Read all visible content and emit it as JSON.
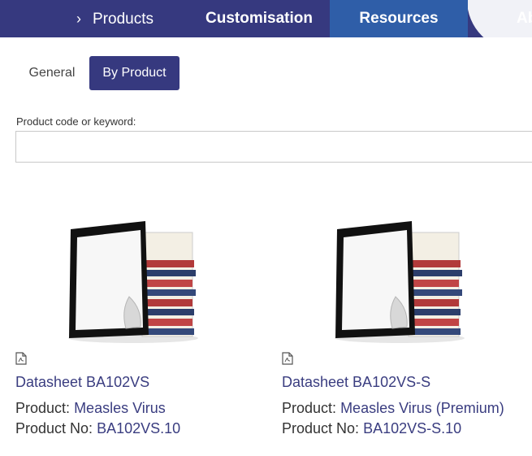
{
  "nav": {
    "items": [
      {
        "label": "Products"
      },
      {
        "label": "Customisation"
      },
      {
        "label": "Resources"
      },
      {
        "label": "Ab"
      }
    ]
  },
  "tabs": [
    {
      "label": "General"
    },
    {
      "label": "By Product"
    }
  ],
  "search": {
    "label": "Product code or keyword:",
    "value": "",
    "placeholder": ""
  },
  "results": [
    {
      "title": "Datasheet BA102VS",
      "product_label": "Product:",
      "product_value": "Measles Virus",
      "number_label": "Product No:",
      "number_value": "BA102VS.10"
    },
    {
      "title": "Datasheet BA102VS-S",
      "product_label": "Product:",
      "product_value": "Measles Virus (Premium)",
      "number_label": "Product No:",
      "number_value": "BA102VS-S.10"
    }
  ],
  "colors": {
    "nav_bg": "#36397f",
    "nav_active": "#2f5ea8",
    "link": "#3a3d80"
  },
  "icons": {
    "nav_chevron": "chevron-right-icon",
    "file": "pdf-icon",
    "thumbnail": "tablet-books-icon"
  }
}
